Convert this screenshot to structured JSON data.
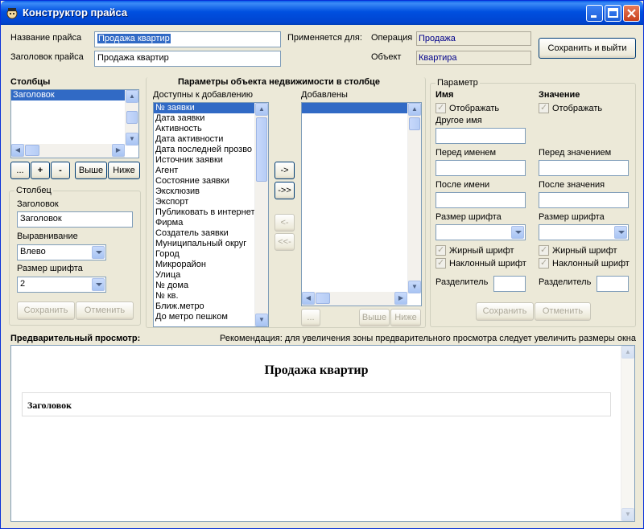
{
  "window": {
    "title": "Конструктор прайса",
    "colors": {
      "titlebar": "#0054e3",
      "selection": "#316ac5",
      "face": "#ece9d8"
    }
  },
  "header": {
    "price_name_label": "Название прайса",
    "price_name_value": "Продажа квартир",
    "price_heading_label": "Заголовок прайса",
    "price_heading_value": "Продажа квартир",
    "applies_label": "Применяется для:",
    "operation_label": "Операция",
    "operation_value": "Продажа",
    "object_label": "Объект",
    "object_value": "Квартира",
    "save_exit_label": "Сохранить и выйти"
  },
  "columns": {
    "title": "Столбцы",
    "items": [
      "Заголовок"
    ],
    "btn_more": "...",
    "btn_add": "+",
    "btn_remove": "-",
    "btn_up": "Выше",
    "btn_down": "Ниже"
  },
  "column": {
    "group_title": "Столбец",
    "heading_label": "Заголовок",
    "heading_value": "Заголовок",
    "align_label": "Выравнивание",
    "align_value": "Влево",
    "font_size_label": "Размер шрифта",
    "font_size_value": "2",
    "save_label": "Сохранить",
    "cancel_label": "Отменить"
  },
  "params": {
    "title": "Параметры объекта недвижимости в столбце",
    "available_label": "Доступны к добавлению",
    "available_items": [
      "№ заявки",
      "Дата заявки",
      "Активность",
      "Дата активности",
      "Дата последней прозво",
      "Источник заявки",
      "Агент",
      "Состояние заявки",
      "Эксклюзив",
      "Экспорт",
      "Публиковать в интернет",
      "Фирма",
      "Создатель заявки",
      "Муниципальный округ",
      "Город",
      "Микрорайон",
      "Улица",
      "№ дома",
      "№ кв.",
      "Ближ.метро",
      "До метро пешком"
    ],
    "added_label": "Добавлены",
    "btn_add": "->",
    "btn_add_all": "->>",
    "btn_remove": "<-",
    "btn_remove_all": "<<-",
    "btn_more": "...",
    "btn_up": "Выше",
    "btn_down": "Ниже"
  },
  "parameter": {
    "group_title": "Параметр",
    "name_header": "Имя",
    "value_header": "Значение",
    "show_label": "Отображать",
    "show_value_label": "Отображать",
    "other_name_label": "Другое имя",
    "before_name_label": "Перед именем",
    "after_name_label": "После имени",
    "before_value_label": "Перед значением",
    "after_value_label": "После значения",
    "font_size_label": "Размер шрифта",
    "font_size_value_label": "Размер шрифта",
    "bold_label": "Жирный шрифт",
    "italic_label": "Наклонный шрифт",
    "bold_value_label": "Жирный шрифт",
    "italic_value_label": "Наклонный шрифт",
    "separator_label": "Разделитель",
    "separator_value_label": "Разделитель",
    "save_label": "Сохранить",
    "cancel_label": "Отменить"
  },
  "preview": {
    "label": "Предварительный просмотр:",
    "hint": "Рекомендация: для увеличения зоны предварительного просмотра следует увеличить размеры окна",
    "title": "Продажа квартир",
    "column_heading": "Заголовок"
  }
}
